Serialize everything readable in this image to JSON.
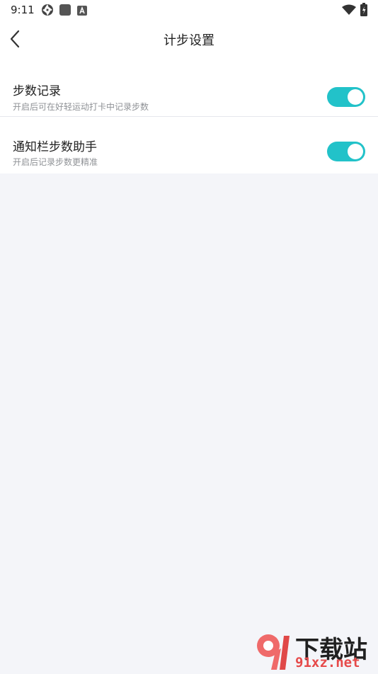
{
  "status_bar": {
    "time": "9:11",
    "icons": [
      "aperture-icon",
      "app-square-icon",
      "a-letter-icon",
      "wifi-icon",
      "battery-charging-icon"
    ]
  },
  "header": {
    "title": "计步设置",
    "back_icon": "chevron-left-icon"
  },
  "settings": [
    {
      "title": "步数记录",
      "subtitle": "开启后可在好轻运动打卡中记录步数",
      "enabled": true
    },
    {
      "title": "通知栏步数助手",
      "subtitle": "开启后记录步数更精准",
      "enabled": true
    }
  ],
  "colors": {
    "accent": "#22c2c9",
    "background": "#f4f5f9",
    "card": "#ffffff",
    "watermark_red": "#e64a4a"
  },
  "watermark": {
    "brand": "下载站",
    "domain": "91xz.net",
    "logo_text": "91"
  }
}
